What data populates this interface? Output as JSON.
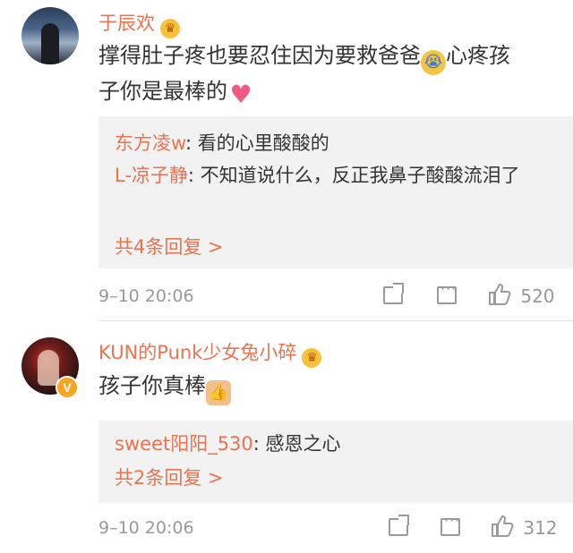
{
  "comments": [
    {
      "username": "于辰欢",
      "text_line1": "撑得肚子疼也要忍住因为要救爸爸",
      "text_line1_tail": "心疼孩",
      "text_line2": "子你是最棒的",
      "replies": [
        {
          "name": "东方凌w",
          "text": ": 看的心里酸酸的"
        },
        {
          "name": "L-凉子静",
          "text": ": 不知道说什么，反正我鼻子酸酸流泪了"
        }
      ],
      "more_replies": "共4条回复 >",
      "time": "9–10 20:06",
      "like_count": "520"
    },
    {
      "username": "KUN的Punk少女兔小碎",
      "text_line1": "孩子你真棒",
      "replies": [
        {
          "name": "sweet阳阳_530",
          "text": ": 感恩之心"
        }
      ],
      "more_replies": "共2条回复 >",
      "time": "9–10 20:06",
      "like_count": "312"
    }
  ],
  "icons": {
    "crown": "crown-badge-icon",
    "verified": "verified-v-icon",
    "share": "share-icon",
    "comment": "comment-icon",
    "like": "thumbs-up-icon"
  },
  "colors": {
    "accent": "#eb7350",
    "meta": "#999999",
    "reply_bg": "#f2f2f2"
  }
}
